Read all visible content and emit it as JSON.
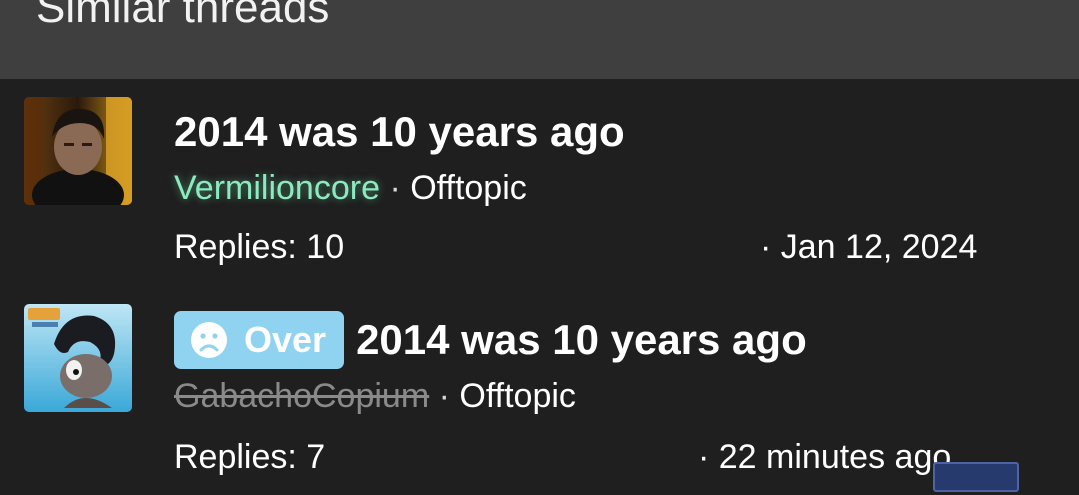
{
  "header": {
    "title": "Similar threads"
  },
  "threads": [
    {
      "title": "2014 was 10 years ago",
      "prefix": "",
      "author": "Vermilioncore",
      "separator": "·",
      "forum": "Offtopic",
      "replies": "Replies: 10",
      "date": "· Jan 12, 2024"
    },
    {
      "title": "2014 was 10 years ago",
      "prefix": "Over",
      "prefix_icon": "sad-face-icon",
      "author": "GabachoCopium",
      "separator": "·",
      "forum": "Offtopic",
      "replies": "Replies: 7",
      "date": "· 22 minutes ago"
    }
  ],
  "colors": {
    "header_bg": "#3f3f3f",
    "page_bg": "#1f1f1f",
    "author_green": "#8de9c0",
    "badge_blue": "#8fd3f0",
    "banned_gray": "#8a8a8a"
  }
}
